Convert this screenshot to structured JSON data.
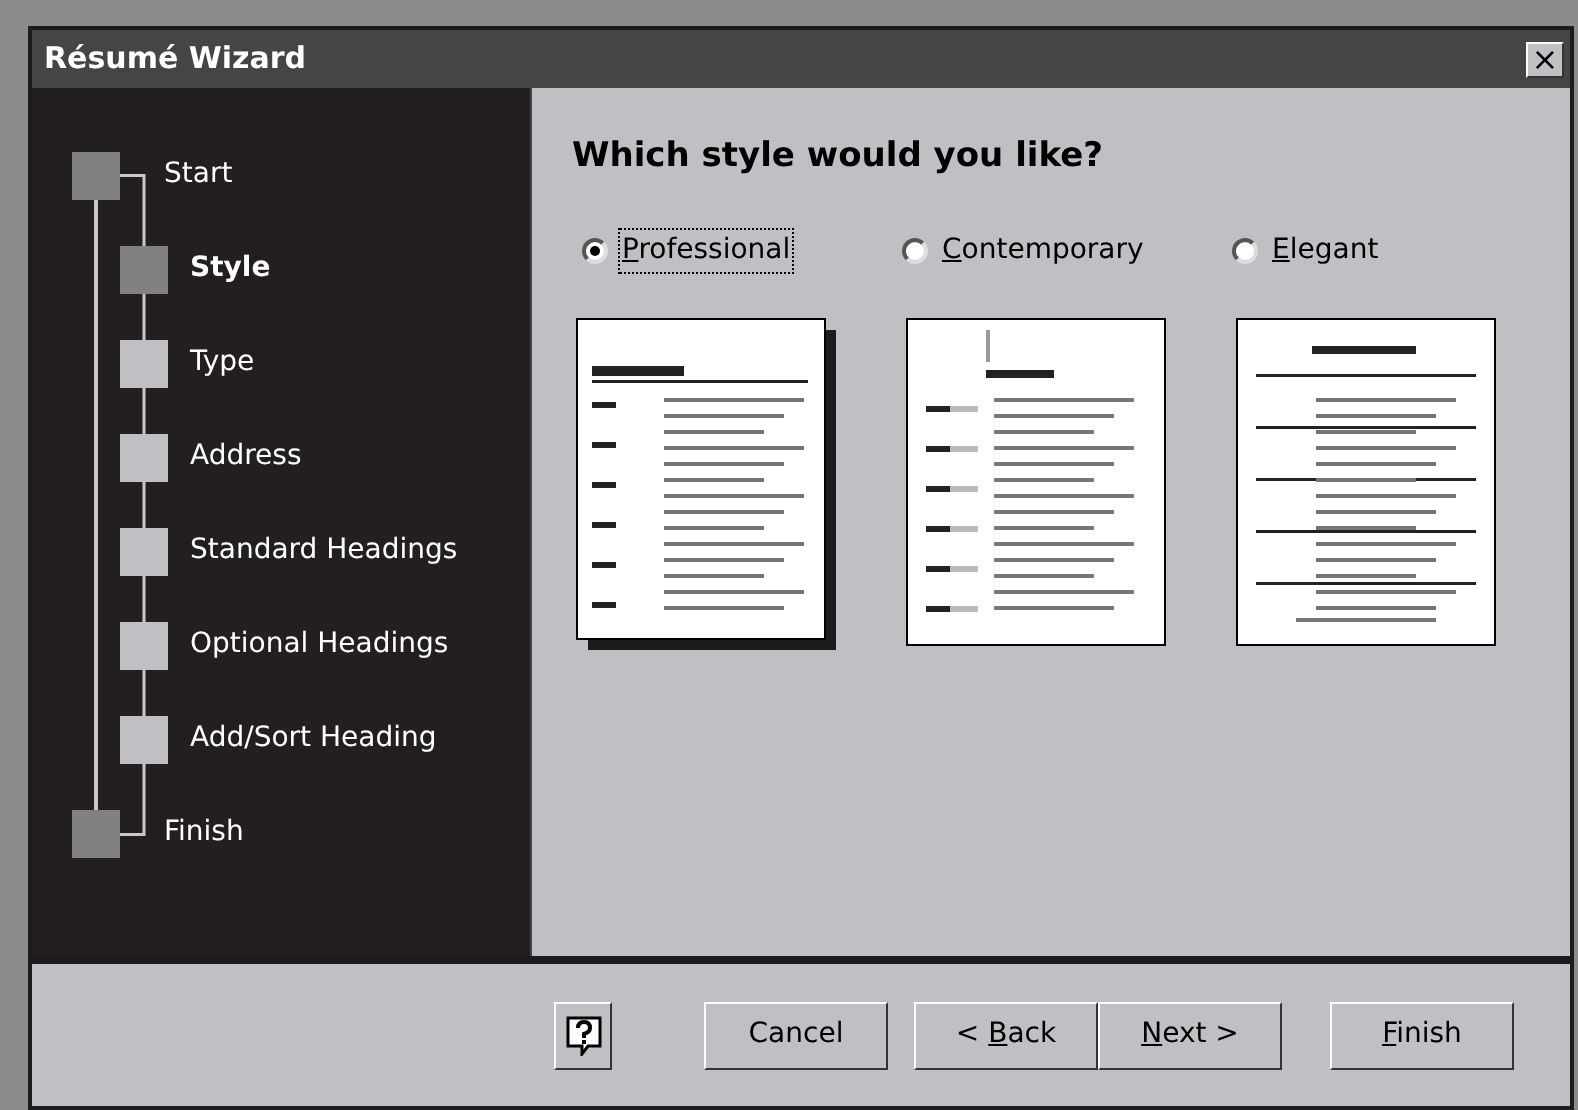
{
  "window": {
    "title": "Résumé Wizard",
    "close": "×"
  },
  "steps": [
    {
      "label": "Start",
      "kind": "endpoint",
      "selected": false
    },
    {
      "label": "Style",
      "kind": "step",
      "selected": true
    },
    {
      "label": "Type",
      "kind": "step",
      "selected": false
    },
    {
      "label": "Address",
      "kind": "step",
      "selected": false
    },
    {
      "label": "Standard Headings",
      "kind": "step",
      "selected": false
    },
    {
      "label": "Optional Headings",
      "kind": "step",
      "selected": false
    },
    {
      "label": "Add/Sort Heading",
      "kind": "step",
      "selected": false
    },
    {
      "label": "Finish",
      "kind": "endpoint",
      "selected": false
    }
  ],
  "question": "Which style would you like?",
  "styles": [
    {
      "key": "P",
      "after": "rofessional",
      "selected": true,
      "kind": "professional"
    },
    {
      "key": "C",
      "after": "ontemporary",
      "selected": false,
      "kind": "contemporary"
    },
    {
      "key": "E",
      "after": "legant",
      "selected": false,
      "kind": "elegant"
    }
  ],
  "buttons": [
    {
      "before": "Cancel"
    },
    {
      "before": "< ",
      "key": "B",
      "after": "ack"
    },
    {
      "key": "N",
      "after": "ext >"
    },
    {
      "key": "F",
      "after": "inish"
    }
  ]
}
